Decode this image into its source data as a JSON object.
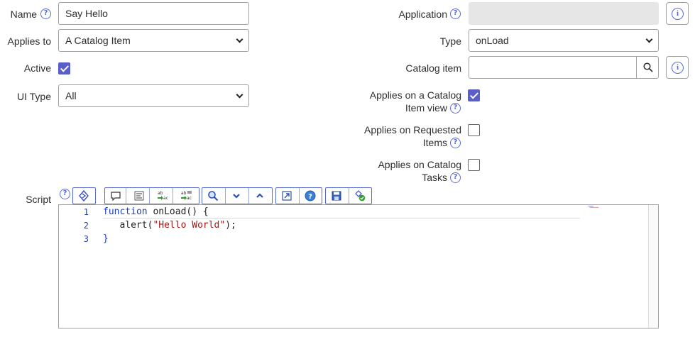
{
  "fields": {
    "name": {
      "label": "Name",
      "value": "Say Hello"
    },
    "applies_to": {
      "label": "Applies to",
      "value": "A Catalog Item"
    },
    "active": {
      "label": "Active",
      "checked": true
    },
    "ui_type": {
      "label": "UI Type",
      "value": "All"
    },
    "application": {
      "label": "Application",
      "value": ""
    },
    "type": {
      "label": "Type",
      "value": "onLoad"
    },
    "catalog_item": {
      "label": "Catalog item",
      "value": ""
    },
    "applies_catalog_item_view": {
      "label_line1": "Applies on a Catalog",
      "label_line2": "Item view",
      "checked": true
    },
    "applies_requested_items": {
      "label_line1": "Applies on Requested",
      "label_line2": "Items",
      "checked": false
    },
    "applies_catalog_tasks": {
      "label_line1": "Applies on Catalog",
      "label_line2": "Tasks",
      "checked": false
    },
    "script": {
      "label": "Script"
    }
  },
  "icons": {
    "help": "?",
    "info": "i"
  },
  "toolbar": [
    "toggle-syntax-icon",
    "comment-icon",
    "format-icon",
    "replace-icon",
    "replace-all-icon",
    "search-icon",
    "next-icon",
    "previous-icon",
    "fullscreen-icon",
    "help-icon",
    "save-icon",
    "check-script-icon"
  ],
  "editor": {
    "line_numbers": [
      "1",
      "2",
      "3"
    ],
    "line1_keyword": "function",
    "line1_rest": " onLoad() {",
    "line2_prefix": "   alert(",
    "line2_string": "\"Hello World\"",
    "line2_suffix": ");",
    "line3": "}"
  },
  "colors": {
    "accent": "#5a5fc7",
    "border": "#a0a0a0",
    "keyword": "#1a3cc1",
    "string": "#a31515"
  }
}
